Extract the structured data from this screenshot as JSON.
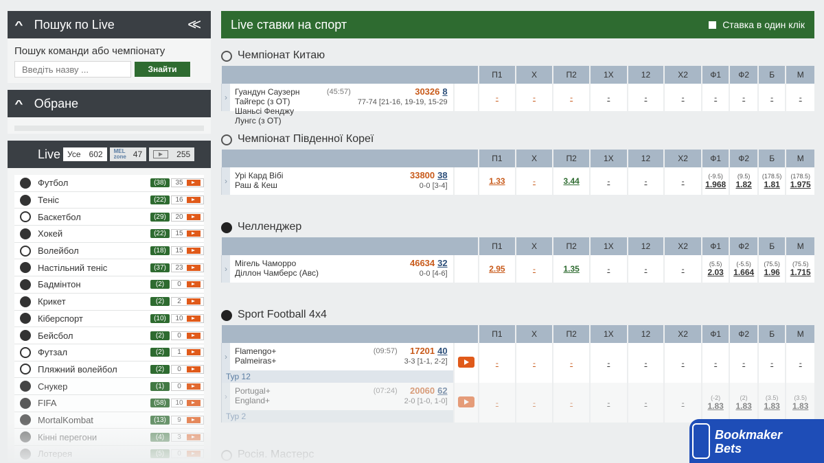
{
  "search_panel": {
    "title": "Пошук по Live",
    "label": "Пошук команди або чемпіонату",
    "placeholder": "Введіть назву ...",
    "button": "Знайти"
  },
  "favorites_panel": {
    "title": "Обране"
  },
  "live_panel": {
    "title": "Live",
    "filters": [
      {
        "label": "Усе",
        "count": "602"
      },
      {
        "label": "MEL zone",
        "count": "47"
      },
      {
        "label": "video",
        "count": "255"
      }
    ],
    "sports": [
      {
        "name": "Футбол",
        "live": "(38)",
        "video": "35",
        "icon": "soccer-ball-icon"
      },
      {
        "name": "Теніс",
        "live": "(22)",
        "video": "16",
        "icon": "tennis-ball-icon"
      },
      {
        "name": "Баскетбол",
        "live": "(29)",
        "video": "20",
        "icon": "basketball-icon"
      },
      {
        "name": "Хокей",
        "live": "(22)",
        "video": "15",
        "icon": "hockey-puck-icon"
      },
      {
        "name": "Волейбол",
        "live": "(18)",
        "video": "15",
        "icon": "volleyball-icon"
      },
      {
        "name": "Настільний теніс",
        "live": "(37)",
        "video": "23",
        "icon": "table-tennis-icon"
      },
      {
        "name": "Бадмінтон",
        "live": "(2)",
        "video": "0",
        "icon": "shuttlecock-icon"
      },
      {
        "name": "Крикет",
        "live": "(2)",
        "video": "2",
        "icon": "cricket-bat-icon"
      },
      {
        "name": "Кіберспорт",
        "live": "(10)",
        "video": "10",
        "icon": "gamepad-icon"
      },
      {
        "name": "Бейсбол",
        "live": "(2)",
        "video": "0",
        "icon": "baseball-icon"
      },
      {
        "name": "Футзал",
        "live": "(2)",
        "video": "1",
        "icon": "futsal-ball-icon"
      },
      {
        "name": "Пляжний волейбол",
        "live": "(2)",
        "video": "0",
        "icon": "beach-volleyball-icon"
      },
      {
        "name": "Снукер",
        "live": "(1)",
        "video": "0",
        "icon": "snooker-icon"
      },
      {
        "name": "FIFA",
        "live": "(58)",
        "video": "10",
        "icon": "fifa-icon"
      },
      {
        "name": "MortalKombat",
        "live": "(13)",
        "video": "9",
        "icon": "mortalkombat-icon"
      },
      {
        "name": "Кінні перегони",
        "live": "(4)",
        "video": "3",
        "icon": "horse-icon"
      },
      {
        "name": "Лотерея",
        "live": "(5)",
        "video": "0",
        "icon": "lottery-icon"
      }
    ]
  },
  "main": {
    "title": "Live ставки на спорт",
    "one_click": "Ставка в один клік",
    "columns": [
      "П1",
      "Х",
      "П2",
      "1Х",
      "12",
      "Х2",
      "Ф1",
      "Ф2",
      "Б",
      "М"
    ],
    "dash": "-",
    "championships": [
      {
        "name": "Чемпіонат Китаю",
        "icon": "basketball-icon",
        "matches": [
          {
            "team1": "Гуандун Саузерн Тайгерс (з ОТ)",
            "team2": "Шаньсі Фенджу Лунгс (з ОТ)",
            "time": "(45:57)",
            "id": "30326",
            "markets": "8",
            "score": "77-74 [21-16, 19-19, 15-29",
            "tour": "",
            "odds": [
              "-",
              "-",
              "-",
              "-",
              "-",
              "-",
              "-",
              "-",
              "-",
              "-"
            ],
            "totals": [
              "",
              "",
              "",
              "",
              "",
              "",
              "",
              "",
              "",
              ""
            ]
          }
        ]
      },
      {
        "name": "Чемпіонат Південної Кореї",
        "icon": "volleyball-icon",
        "matches": [
          {
            "team1": "Урі Кард Вібі",
            "team2": "Раш & Кеш",
            "time": "",
            "id": "33800",
            "markets": "38",
            "score": "0-0 [3-4]",
            "tour": "",
            "odds": [
              "1.33",
              "-",
              "3.44",
              "-",
              "-",
              "-",
              "1.968",
              "1.82",
              "1.81",
              "1.975"
            ],
            "totals": [
              "",
              "",
              "",
              "",
              "",
              "",
              "(-9.5)",
              "(9.5)",
              "(178.5)",
              "(178.5)"
            ]
          }
        ]
      },
      {
        "name": "Челленджер",
        "icon": "table-tennis-icon",
        "matches": [
          {
            "team1": "Мігель Чаморро",
            "team2": "Діллон Чамберс (Авс)",
            "time": "",
            "id": "46634",
            "markets": "32",
            "score": "0-0 [4-6]",
            "tour": "",
            "odds": [
              "2.95",
              "-",
              "1.35",
              "-",
              "-",
              "-",
              "2.03",
              "1.664",
              "1.96",
              "1.715"
            ],
            "totals": [
              "",
              "",
              "",
              "",
              "",
              "",
              "(5.5)",
              "(-5.5)",
              "(75.5)",
              "(75.5)"
            ]
          }
        ]
      },
      {
        "name": "Sport Football 4x4",
        "icon": "soccer-ball-icon",
        "matches": [
          {
            "team1": "Flamengo+",
            "team2": "Palmeiras+",
            "time": "(09:57)",
            "id": "17201",
            "markets": "40",
            "score": "3-3 [1-1, 2-2]",
            "tour": "Тур 12",
            "odds": [
              "-",
              "-",
              "-",
              "-",
              "-",
              "-",
              "-",
              "-",
              "-",
              "-"
            ],
            "totals": [
              "",
              "",
              "",
              "",
              "",
              "",
              "",
              "",
              "",
              ""
            ]
          },
          {
            "team1": "Portugal+",
            "team2": "England+",
            "time": "(07:24)",
            "id": "20060",
            "markets": "62",
            "score": "2-0 [1-0, 1-0]",
            "tour": "Тур 2",
            "odds": [
              "-",
              "-",
              "-",
              "-",
              "-",
              "-",
              "1.83",
              "1.83",
              "1.83",
              "1.83"
            ],
            "totals": [
              "",
              "",
              "",
              "",
              "",
              "",
              "(-2)",
              "(2)",
              "(3.5)",
              "(3.5)"
            ]
          }
        ]
      },
      {
        "name": "Росія. Мастерс",
        "icon": "tennis-ball-icon",
        "matches": []
      }
    ]
  },
  "watermark": {
    "line1": "Bookmaker",
    "line2": "Bets"
  }
}
